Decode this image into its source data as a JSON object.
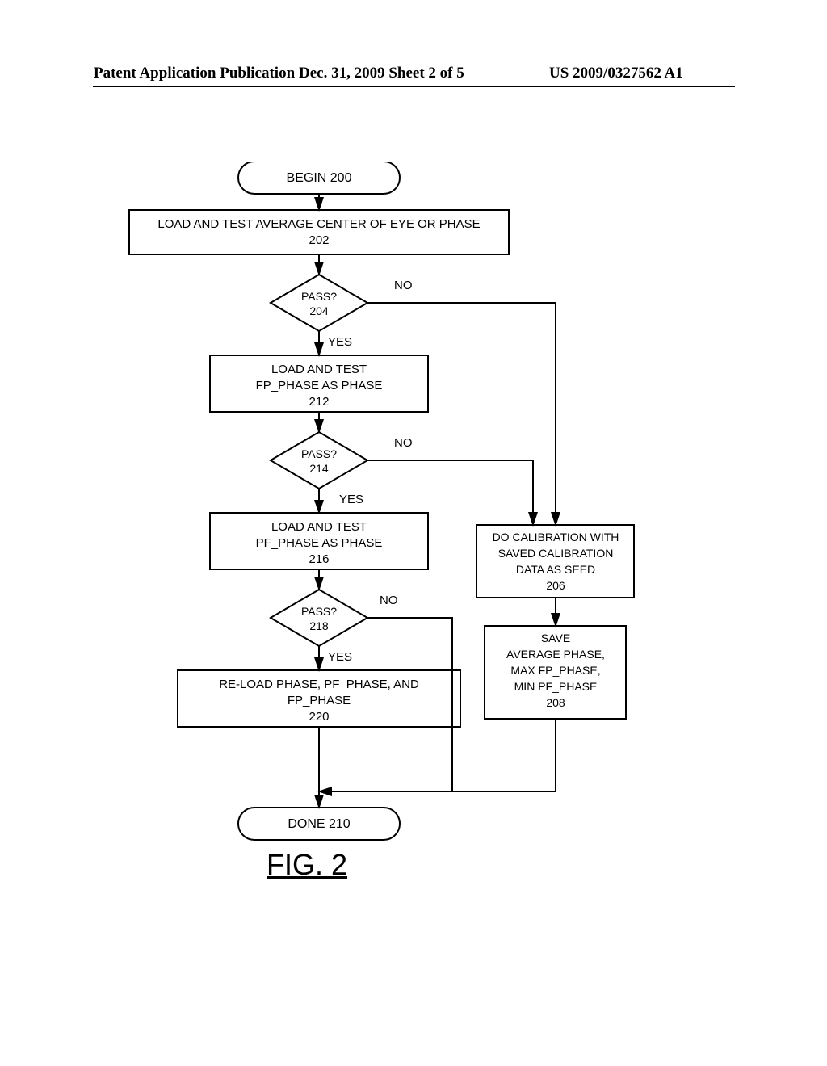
{
  "header": {
    "left": "Patent Application Publication",
    "center": "Dec. 31, 2009  Sheet 2 of 5",
    "right": "US 2009/0327562 A1"
  },
  "flow": {
    "begin": "BEGIN 200",
    "b202_l1": "LOAD AND TEST AVERAGE CENTER OF EYE OR PHASE",
    "b202_l2": "202",
    "d204_l1": "PASS?",
    "d204_l2": "204",
    "yes": "YES",
    "no": "NO",
    "b212_l1": "LOAD AND TEST",
    "b212_l2": "FP_PHASE  AS PHASE",
    "b212_l3": "212",
    "d214_l1": "PASS?",
    "d214_l2": "214",
    "b216_l1": "LOAD AND TEST",
    "b216_l2": "PF_PHASE  AS PHASE",
    "b216_l3": "216",
    "d218_l1": "PASS?",
    "d218_l2": "218",
    "b220_l1": "RE-LOAD PHASE, PF_PHASE, AND",
    "b220_l2": "FP_PHASE",
    "b220_l3": "220",
    "b206_l1": "DO CALIBRATION WITH",
    "b206_l2": "SAVED CALIBRATION",
    "b206_l3": "DATA AS SEED",
    "b206_l4": "206",
    "b208_l1": "SAVE",
    "b208_l2": "AVERAGE PHASE,",
    "b208_l3": "MAX FP_PHASE,",
    "b208_l4": "MIN PF_PHASE",
    "b208_l5": "208",
    "done": "DONE 210"
  },
  "figure_label": "FIG. 2"
}
